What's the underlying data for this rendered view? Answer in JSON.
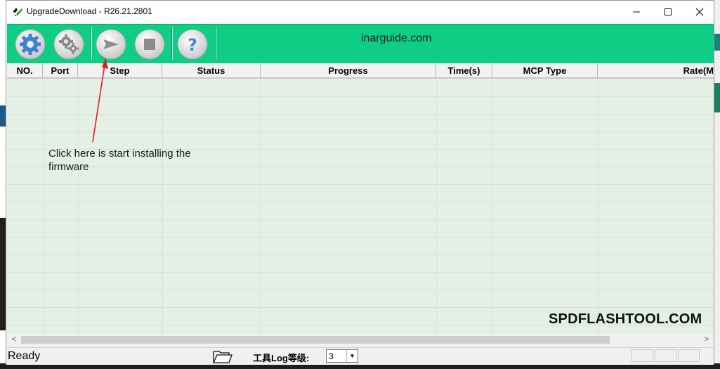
{
  "window": {
    "title": "UpgradeDownload - R26.21.2801",
    "controls": {
      "minimize": "—",
      "maximize": "☐",
      "close": "✕"
    }
  },
  "toolbar": {
    "buttons": [
      {
        "name": "load-packet-icon"
      },
      {
        "name": "settings-icon"
      },
      {
        "name": "start-download-icon"
      },
      {
        "name": "stop-icon"
      },
      {
        "name": "help-icon"
      }
    ],
    "watermark": "inarguide.com",
    "background_color": "#0dce84"
  },
  "table": {
    "columns": [
      "NO.",
      "Port",
      "Step",
      "Status",
      "Progress",
      "Time(s)",
      "MCP Type",
      "Rate(M"
    ],
    "rows": []
  },
  "annotation": {
    "text": "Click here is start installing the firmware",
    "arrow_color": "#e0201c"
  },
  "watermark_bottom": "SPDFLASHTOOL.COM",
  "scrollbar": {
    "left_arrow": "<",
    "right_arrow": ">"
  },
  "statusbar": {
    "status": "Ready",
    "log_label": "工具Log等级:",
    "log_level": "3"
  }
}
